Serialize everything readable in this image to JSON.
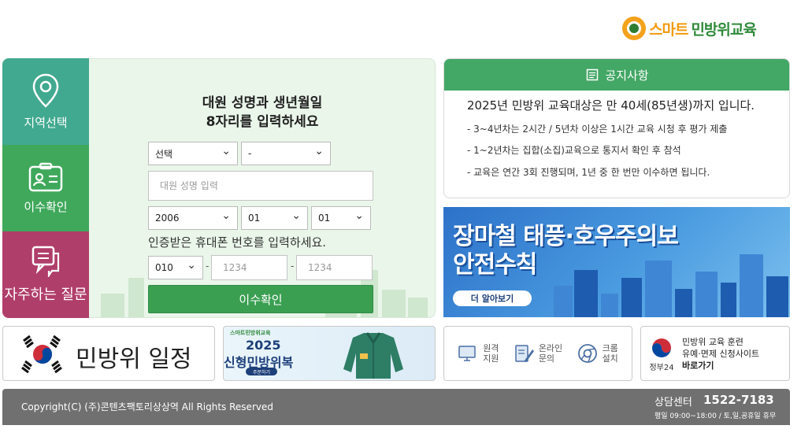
{
  "header": {
    "logo_part1": "스마트",
    "logo_part2": "민방위교육"
  },
  "tabs": [
    {
      "label": "지역선택",
      "icon": "location-pin-icon"
    },
    {
      "label": "이수확인",
      "icon": "id-card-icon"
    },
    {
      "label": "자주하는 질문",
      "icon": "chat-bubble-icon"
    }
  ],
  "form": {
    "title_line1": "대원 성명과 생년월일",
    "title_line2": "8자리를 입력하세요",
    "region_select": "선택",
    "subregion_select": "-",
    "name_placeholder": "대원 성명 입력",
    "birth_year": "2006",
    "birth_month": "01",
    "birth_day": "01",
    "phone_label": "인증받은 휴대폰 번호를 입력하세요.",
    "phone_prefix": "010",
    "phone_mid_placeholder": "1234",
    "phone_last_placeholder": "1234",
    "dash": "-",
    "submit_label": "이수확인"
  },
  "notice": {
    "title": "공지사항",
    "headline": "2025년 민방위 교육대상은 만 40세(85년생)까지 입니다.",
    "lines": [
      "- 3~4년차는 2시간 / 5년차 이상은 1시간 교육 시청 후 평가 제출",
      "- 1~2년차는 집합(소집)교육으로 통지서 확인 후 참석",
      "- 교육은 연간 3회 진행되며, 1년 중 한 번만 이수하면 됩니다."
    ]
  },
  "banner": {
    "title_line1": "장마철 태풍·호우주의보",
    "title_line2": "안전수칙",
    "button": "더 알아보기"
  },
  "cards": {
    "schedule": "민방위 일정",
    "uniform_brand": "스마트민방위교육",
    "uniform_year": "2025",
    "uniform_title": "신형민방위복",
    "uniform_button": "주문하기",
    "support": [
      {
        "line1": "원격",
        "line2": "지원"
      },
      {
        "line1": "온라인",
        "line2": "문의"
      },
      {
        "line1": "크롬",
        "line2": "설치"
      }
    ],
    "portal_gov": "정부24",
    "portal_line1": "민방위 교육 훈련",
    "portal_line2": "유예·면제 신청사이트",
    "portal_line3": "바로가기"
  },
  "footer": {
    "copyright": "Copyright(C) (주)콘텐츠팩토리상상역 All Rights Reserved",
    "cs_label": "상담센터",
    "cs_phone": "1522-7183",
    "cs_hours": "평일 09:00~18:00 / 토,일,공휴일 휴무"
  },
  "colors": {
    "primary_green": "#3fa85b",
    "teal": "#41a98f",
    "magenta": "#b03e6a",
    "logo_orange": "#f39a10"
  }
}
